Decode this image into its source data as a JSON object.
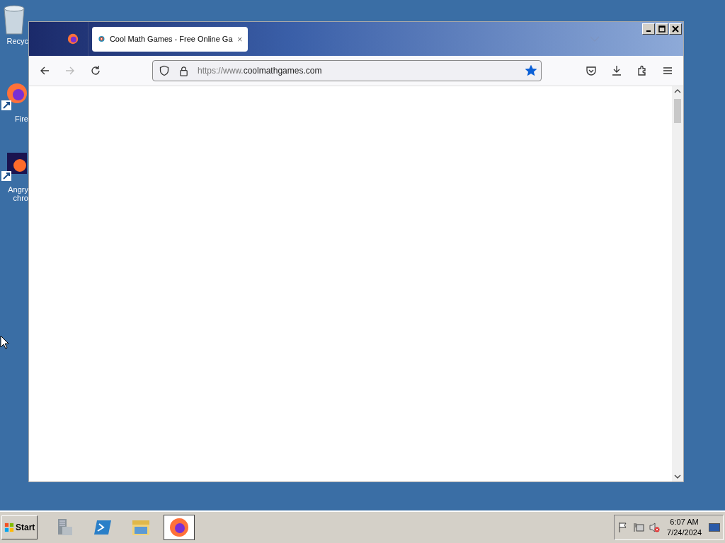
{
  "desktop_icons": [
    {
      "kind": "recycle-bin",
      "lines": [
        "Recyc"
      ]
    },
    {
      "kind": "firefox",
      "lines": [
        "Fire"
      ]
    },
    {
      "kind": "game",
      "lines": [
        "Angry",
        "chro"
      ]
    }
  ],
  "browser": {
    "tabs": [
      {
        "title": "Cool Math Games - Free Online Ga",
        "selected": true
      }
    ],
    "nav": {
      "back_disabled": false,
      "forward_disabled": true
    },
    "url": {
      "prefix": "https://www.",
      "host": "coolmathgames.com",
      "bookmarked": true
    }
  },
  "taskbar": {
    "start": "Start",
    "items": [
      {
        "kind": "server-manager",
        "selected": false
      },
      {
        "kind": "powershell",
        "selected": false
      },
      {
        "kind": "explorer",
        "selected": false
      },
      {
        "kind": "firefox",
        "selected": true
      }
    ],
    "clock": {
      "time": "6:07 AM",
      "date": "7/24/2024"
    }
  }
}
